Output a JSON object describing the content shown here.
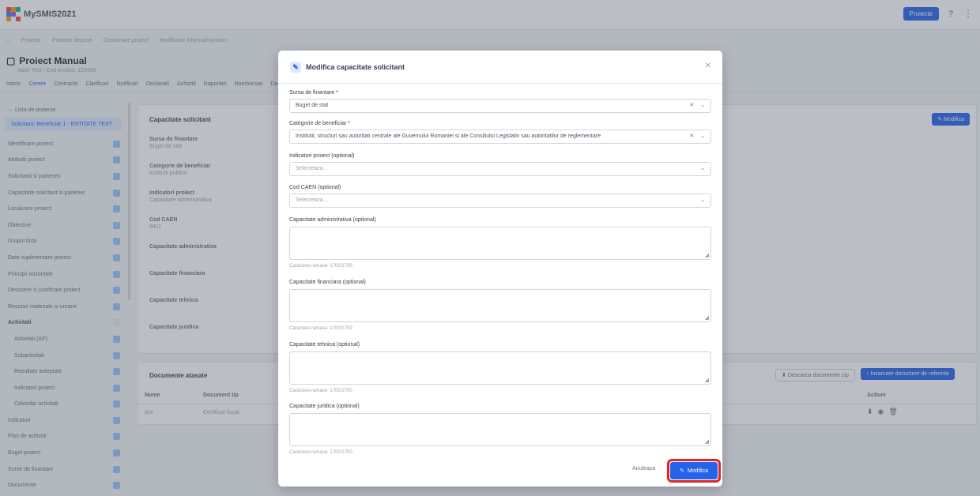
{
  "app": {
    "name": "MySMIS2021"
  },
  "topbar": {
    "action_label": "Proiecte",
    "icon_1": "question-icon",
    "icon_2": "more-icon"
  },
  "breadcrumb": [
    "Proiecte",
    "Proiecte depuse",
    "Gestionare proiect",
    "Modificare informatii proiect"
  ],
  "project": {
    "title": "Proiect Manual",
    "subtitle": "Apel: Test | Cod proiect: 123456"
  },
  "tabs": [
    "Istoric",
    "Cerere",
    "Contracte",
    "Clarificari",
    "Notificari",
    "Declaratii",
    "Achizitii",
    "Raportari",
    "Rambursari",
    "Documente"
  ],
  "sidebar": {
    "back": "Lista de proiecte",
    "selected": "Solicitant: Beneficiar 1 - ENTITATE TEST",
    "items": [
      {
        "label": "Identificare proiect",
        "type": "item"
      },
      {
        "label": "Atributii proiect",
        "type": "item"
      },
      {
        "label": "Solicitanti si parteneri",
        "type": "item"
      },
      {
        "label": "Capacitate solicitant si partener",
        "type": "item"
      },
      {
        "label": "Localizare proiect",
        "type": "item"
      },
      {
        "label": "Obiective",
        "type": "item"
      },
      {
        "label": "Grupul tinta",
        "type": "item"
      },
      {
        "label": "Date suplimentare proiect",
        "type": "item"
      },
      {
        "label": "Principii orizontale",
        "type": "item"
      },
      {
        "label": "Descriere si justificare proiect",
        "type": "item"
      },
      {
        "label": "Resurse materiale si umane",
        "type": "item"
      },
      {
        "label": "Activitati",
        "type": "hdr"
      },
      {
        "label": "Activitati (AP)",
        "type": "sub"
      },
      {
        "label": "Subactivitati",
        "type": "sub"
      },
      {
        "label": "Rezultate asteptate",
        "type": "sub"
      },
      {
        "label": "Indicatori proiect",
        "type": "sub"
      },
      {
        "label": "Calendar activitati",
        "type": "sub"
      },
      {
        "label": "Indicatori",
        "type": "item"
      },
      {
        "label": "Plan de achizitii",
        "type": "item"
      },
      {
        "label": "Buget proiect",
        "type": "item"
      },
      {
        "label": "Surse de finantare",
        "type": "item"
      },
      {
        "label": "Documente",
        "type": "item"
      }
    ]
  },
  "info_card": {
    "title": "Capacitate solicitant",
    "edit_label": "Modifica",
    "fields": [
      {
        "label": "Sursa de finantare",
        "value": "Buget de stat"
      },
      {
        "label": "Categorie de beneficiar",
        "value": "Institutii publice"
      },
      {
        "label": "Indicatori proiect",
        "value": "Capacitate administrativa"
      },
      {
        "label": "Cod CAEN",
        "value": "8411"
      },
      {
        "label": "Capacitate administrativa",
        "value": "-"
      },
      {
        "label": "Capacitate financiara",
        "value": ""
      },
      {
        "label": "Capacitate tehnica",
        "value": ""
      },
      {
        "label": "Capacitate juridica",
        "value": ""
      }
    ]
  },
  "docs_card": {
    "title": "Documente atasate",
    "secondary_label": "Descarca documente zip",
    "primary_label": "Incarcare document de referinta",
    "columns": [
      "Nume",
      "Document tip",
      "Actiuni"
    ],
    "rows": [
      {
        "name": "doc",
        "type": "Certificat fiscal"
      }
    ]
  },
  "modal": {
    "title": "Modifica capacitate solicitant",
    "close_icon": "close-icon",
    "fields": {
      "funding_label": "Sursa de finantare *",
      "funding_value": "Buget de stat",
      "category_label": "Categorie de beneficiar *",
      "category_value": "Institutii, structuri sau autoritati centrale ale Guvernului Romaniei si ale Consiliului Legislativ sau autoritatilor de reglementare",
      "indicators_label": "Indicatori proiect (optional)",
      "indicators_placeholder": "Selecteaza...",
      "caen_label": "Cod CAEN (optional)",
      "caen_placeholder": "Selecteaza...",
      "admin_label": "Capacitate administrativa (optional)",
      "admin_hint": "Caractere ramase: 1700/1700",
      "fin_label": "Capacitate financiara (optional)",
      "fin_hint": "Caractere ramase: 1700/1700",
      "tech_label": "Capacitate tehnica (optional)",
      "tech_hint": "Caractere ramase: 1700/1700",
      "legal_label": "Capacitate juridica (optional)",
      "legal_hint": "Caractere ramase: 1700/1700"
    },
    "cancel_label": "Anuleaza",
    "submit_label": "Modifica"
  },
  "colors": {
    "accent": "#2563eb",
    "highlight": "#dc2626",
    "overlay": "#4b5563"
  }
}
